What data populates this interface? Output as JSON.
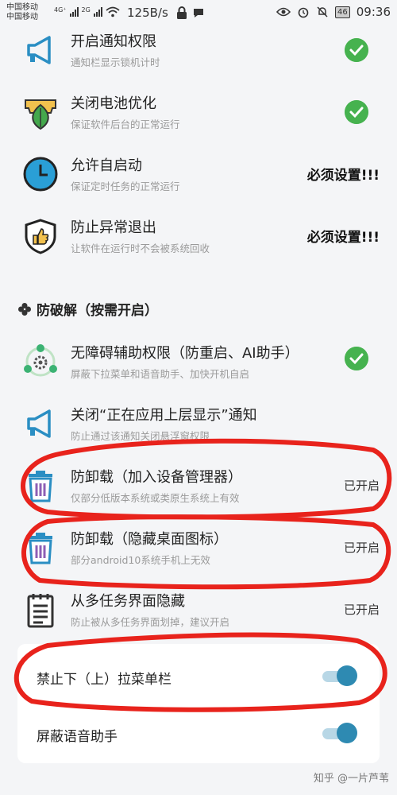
{
  "status_bar": {
    "carrier_1": "中国移动",
    "carrier_2": "中国移动",
    "net_1": "4G⁺",
    "net_2": "2G",
    "speed": "125B/s",
    "battery": "46",
    "time": "09:36"
  },
  "permissions": [
    {
      "title": "开启通知权限",
      "sub": "通知栏显示锁机计时",
      "status": "check",
      "icon": "megaphone-icon"
    },
    {
      "title": "关闭电池优化",
      "sub": "保证软件后台的正常运行",
      "status": "check",
      "icon": "leaf-battery-icon"
    },
    {
      "title": "允许自启动",
      "sub": "保证定时任务的正常运行",
      "status": "必须设置!!!",
      "icon": "clock-icon"
    },
    {
      "title": "防止异常退出",
      "sub": "让软件在运行时不会被系统回收",
      "status": "必须设置!!!",
      "icon": "shield-thumb-icon"
    }
  ],
  "section": {
    "title": "防破解（按需开启）",
    "icon": "clover-icon"
  },
  "anti_crack": [
    {
      "title": "无障碍辅助权限（防重启、AI助手）",
      "sub": "屏蔽下拉菜单和语音助手、加快开机自启",
      "status": "check",
      "icon": "accessibility-gear-icon"
    },
    {
      "title": "关闭“正在应用上层显示”通知",
      "sub": "防止通过该通知关闭悬浮窗权限",
      "status": "",
      "icon": "megaphone-icon"
    },
    {
      "title": "防卸载（加入设备管理器）",
      "sub": "仅部分低版本系统或类原生系统上有效",
      "status": "已开启",
      "icon": "trash-icon"
    },
    {
      "title": "防卸载（隐藏桌面图标）",
      "sub": "部分android10系统手机上无效",
      "status": "已开启",
      "icon": "trash-icon"
    },
    {
      "title": "从多任务界面隐藏",
      "sub": "防止被从多任务界面划掉，建议开启",
      "status": "已开启",
      "icon": "notepad-icon"
    }
  ],
  "toggles": [
    {
      "label": "禁止下（上）拉菜单栏",
      "on": true
    },
    {
      "label": "屏蔽语音助手",
      "on": true
    }
  ],
  "watermark": "知乎 @一片芦苇",
  "colors": {
    "check_green": "#46b24f",
    "toggle_blue": "#2e8ab2",
    "annotation_red": "#e8231c",
    "icon_blue": "#2a8ec3"
  }
}
